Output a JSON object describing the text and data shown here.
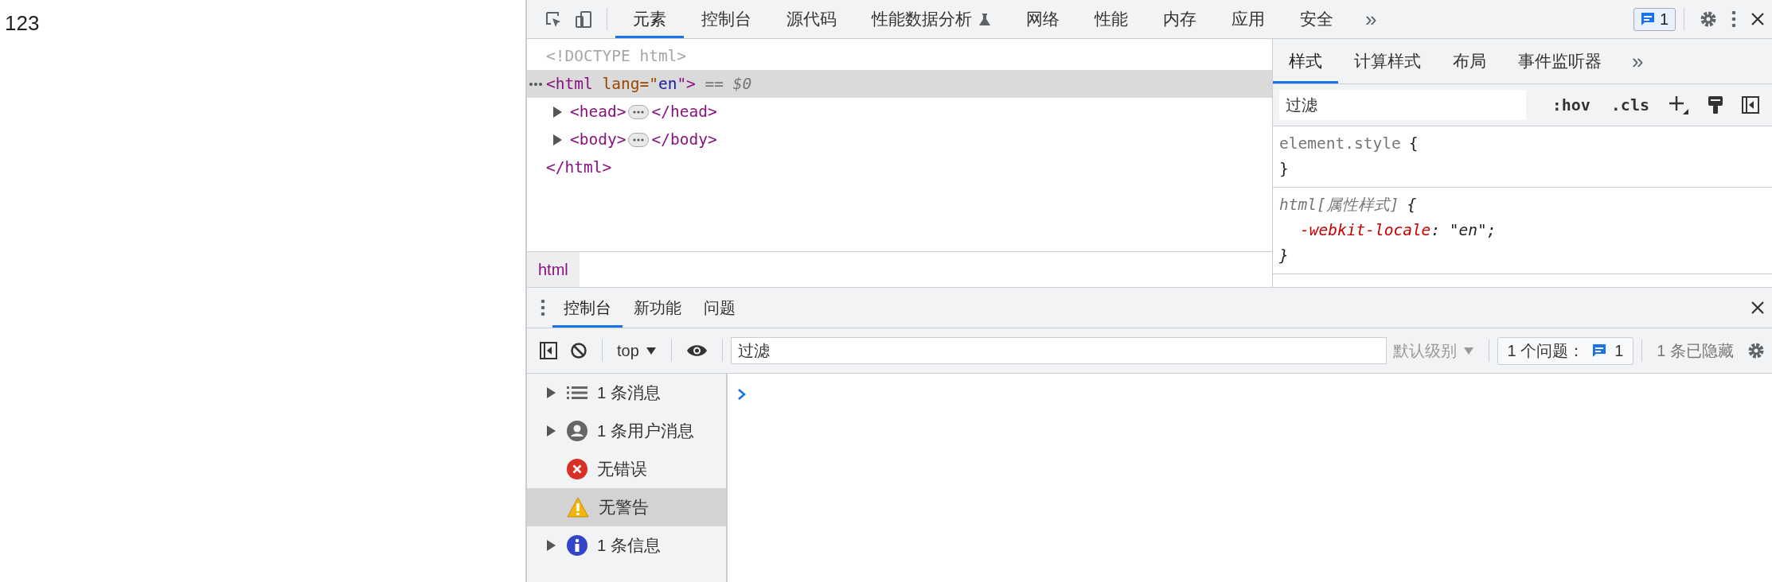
{
  "page": {
    "text": "123"
  },
  "toolbar": {
    "tabs": [
      {
        "label": "元素",
        "selected": true
      },
      {
        "label": "控制台",
        "selected": false
      },
      {
        "label": "源代码",
        "selected": false
      },
      {
        "label": "性能数据分析",
        "selected": false,
        "experimental": true
      },
      {
        "label": "网络",
        "selected": false
      },
      {
        "label": "性能",
        "selected": false
      },
      {
        "label": "内存",
        "selected": false
      },
      {
        "label": "应用",
        "selected": false
      },
      {
        "label": "安全",
        "selected": false
      }
    ],
    "more": "»",
    "issues_count": "1"
  },
  "elements": {
    "dom": [
      {
        "open": [
          {
            "kind": "doctype",
            "text": "<!DOCTYPE html>"
          }
        ]
      },
      {
        "selected": true,
        "open": [
          {
            "kind": "tag",
            "text": "<html"
          },
          {
            "kind": "attr-name",
            "text": " lang=\""
          },
          {
            "kind": "attr-value",
            "text": "en"
          },
          {
            "kind": "tag",
            "text": "\">"
          },
          {
            "kind": "marker",
            "text": " == "
          },
          {
            "kind": "marker-var",
            "text": "$0"
          }
        ],
        "children": [
          {
            "selected": false,
            "expanded": false,
            "open": [
              {
                "kind": "tag",
                "text": "<head>"
              }
            ],
            "close": [
              {
                "kind": "tag",
                "text": "</head>"
              }
            ]
          },
          {
            "selected": false,
            "expanded": false,
            "open": [
              {
                "kind": "tag",
                "text": "<body>"
              }
            ],
            "close": [
              {
                "kind": "tag",
                "text": "</body>"
              }
            ]
          }
        ],
        "close": [
          {
            "kind": "tag",
            "text": "</html>"
          }
        ]
      }
    ],
    "breadcrumbs": [
      {
        "label": "html",
        "selected": true
      }
    ]
  },
  "styles": {
    "tabs": [
      {
        "label": "样式",
        "selected": true
      },
      {
        "label": "计算样式",
        "selected": false
      },
      {
        "label": "布局",
        "selected": false
      },
      {
        "label": "事件监听器",
        "selected": false
      }
    ],
    "more": "»",
    "filter": {
      "placeholder": "过滤"
    },
    "buttons": [
      ":hov",
      ".cls"
    ],
    "rules": [
      {
        "selector": "element.style",
        "italic": false,
        "open": "{",
        "close": "}"
      },
      {
        "selector": "html[属性样式]",
        "italic": true,
        "open": "{",
        "close": "}",
        "declarations": [
          {
            "property": "-webkit-locale",
            "rest": ": \"en\";"
          }
        ]
      }
    ]
  },
  "drawer": {
    "tabs": [
      {
        "label": "控制台",
        "selected": true
      },
      {
        "label": "新功能",
        "selected": false
      },
      {
        "label": "问题",
        "selected": false
      }
    ],
    "context": "top",
    "filter": {
      "placeholder": "过滤"
    },
    "level": {
      "label": "默认级别",
      "disabled": true
    },
    "issues": {
      "label": "1 个问题：",
      "count": "1"
    },
    "hidden": "1 条已隐藏",
    "sidebar": [
      {
        "kind": "messages",
        "label": "1 条消息",
        "expandable": true,
        "selected": false
      },
      {
        "kind": "user",
        "label": "1 条用户消息",
        "expandable": true,
        "selected": false
      },
      {
        "kind": "error",
        "label": "无错误",
        "expandable": false,
        "selected": false
      },
      {
        "kind": "warning",
        "label": "无警告",
        "expandable": false,
        "selected": true
      },
      {
        "kind": "info",
        "label": "1 条信息",
        "expandable": true,
        "selected": false
      }
    ]
  }
}
